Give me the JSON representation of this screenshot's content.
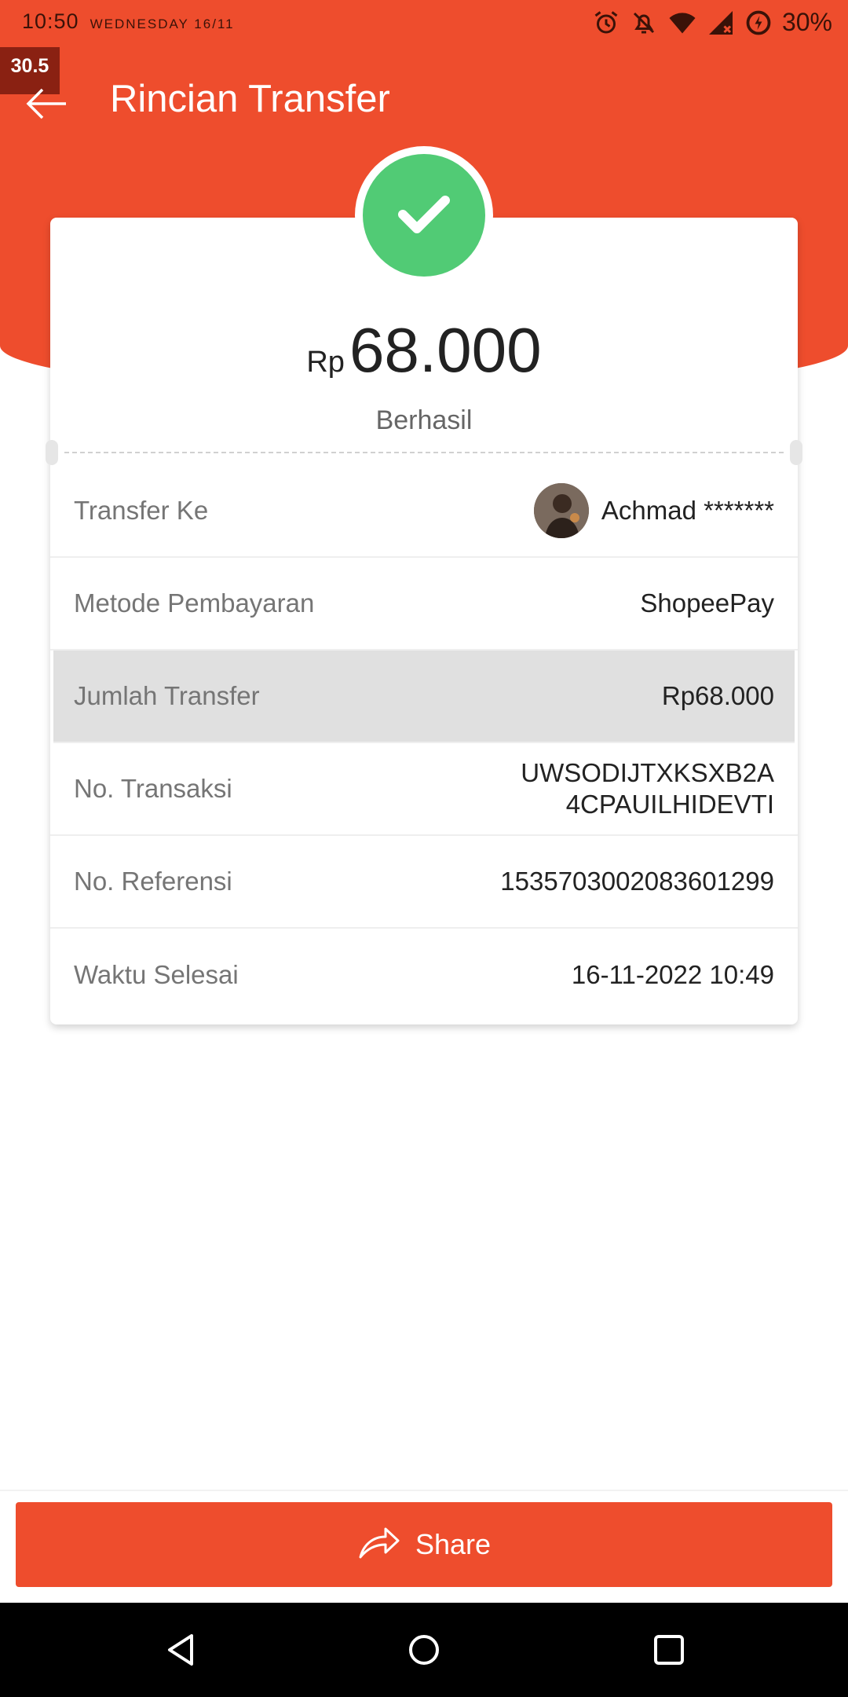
{
  "status_bar": {
    "time": "10:50",
    "date": "WEDNESDAY 16/11",
    "battery": "30%",
    "icons": [
      "alarm-icon",
      "notifications-off-icon",
      "wifi-icon",
      "signal-icon",
      "battery-saver-icon"
    ]
  },
  "overlay": {
    "fps": "30.5"
  },
  "header": {
    "title": "Rincian Transfer",
    "back_icon": "arrow-left-icon"
  },
  "summary": {
    "currency": "Rp",
    "amount": "68.000",
    "status": "Berhasil",
    "status_icon": "check-icon"
  },
  "details": {
    "transfer_to": {
      "label": "Transfer Ke",
      "value": "Achmad *******"
    },
    "payment_method": {
      "label": "Metode Pembayaran",
      "value": "ShopeePay"
    },
    "transfer_amount": {
      "label": "Jumlah Transfer",
      "value": "Rp68.000"
    },
    "transaction_no": {
      "label": "No. Transaksi",
      "value_line1": "UWSODIJTXKSXB2A",
      "value_line2": "4CPAUILHIDEVTI"
    },
    "reference_no": {
      "label": "No. Referensi",
      "value": "1535703002083601299"
    },
    "completed_time": {
      "label": "Waktu Selesai",
      "value": "16-11-2022 10:49"
    }
  },
  "share": {
    "label": "Share",
    "icon": "share-icon"
  },
  "colors": {
    "brand": "#ee4d2d",
    "success": "#51cb75"
  },
  "nav": [
    "back-icon",
    "home-icon",
    "recents-icon"
  ]
}
